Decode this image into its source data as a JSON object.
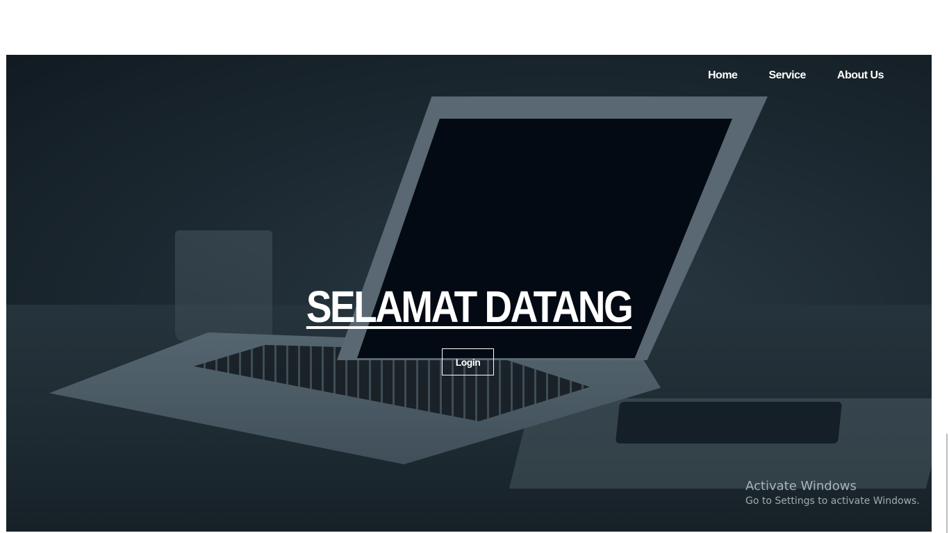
{
  "nav": {
    "items": [
      {
        "label": "Home"
      },
      {
        "label": "Service"
      },
      {
        "label": "About Us"
      }
    ]
  },
  "hero": {
    "title": "SELAMAT DATANG",
    "login_label": "Login"
  },
  "watermark": {
    "title": "Activate Windows",
    "subtitle": "Go to Settings to activate Windows."
  },
  "colors": {
    "text": "#ffffff",
    "screen": "#030711",
    "background": "#2b3a44"
  }
}
